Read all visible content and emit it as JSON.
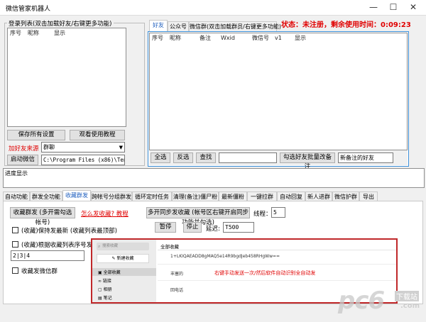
{
  "window": {
    "title": "微信管家机器人",
    "minimize": "—",
    "maximize": "☐",
    "close": "✕"
  },
  "login": {
    "group_label": "登录列表(双击加载好友/右键更多功能)",
    "columns": [
      "序号",
      "昵称",
      "显示"
    ],
    "save_btn": "保存所有设置",
    "tutorial_btn": "观看使用教程",
    "source_label": "加好友来源",
    "source_value": "群聊",
    "start_btn": "启动微信",
    "path_value": "C:\\Program Files (x86)\\Tencent\\We"
  },
  "status": {
    "text": "状态：未注册，剩余使用时间：0:09:23",
    "color": "#e00000"
  },
  "friends": {
    "tabs": [
      "好友",
      "公众号",
      "微信群(双击加载群员/右键更多功能)"
    ],
    "columns": [
      "序号",
      "昵称",
      "备注",
      "Wxid",
      "微信号",
      "v1",
      "显示"
    ],
    "select_all": "全选",
    "invert": "反选",
    "search": "查找",
    "batch_remark": "勾选好友批量改备注",
    "search_value": "",
    "remark_value": "新备注的好友"
  },
  "progress_label": "进度显示",
  "func_tabs": [
    "自动功能",
    "群发全功能",
    "收藏群发",
    "跨帐号分组群发",
    "循环定时任务",
    "清理(备注)僵尸粉",
    "最新僵粉",
    "一键拉群",
    "自动回复",
    "新人进群",
    "微信护群",
    "导出"
  ],
  "collect": {
    "group_send_btn": "收藏群发 (多开需勾选帐号)",
    "how_link": "怎么发收藏? 教程",
    "multi_sync_btn": "多开同步发收藏 (帐号区右键开启同步功能并勾选)",
    "thread_label": "线程：",
    "thread_value": "5",
    "chk_latest": "(收藏)保持发最新 (收藏列表最顶部)",
    "chk_by_index": "(收藏)根据收藏列表序号发",
    "index_value": "2|3|4",
    "chk_wechat_group": "收藏发微信群",
    "pause_btn": "暂停",
    "stop_btn": "停止",
    "delay_label": "延迟:",
    "delay_value": "T500"
  },
  "preview": {
    "search_placeholder": "搜索收藏",
    "new_btn": "新建收藏",
    "side_items": [
      "全部收藏",
      "链接",
      "相册",
      "笔记"
    ],
    "header": "全部收藏",
    "row1": "1+LKIQAEADD8gMAQ5e14R9bgdJeb458RHgWw==",
    "row2": "丰塞的",
    "row3": "回电话",
    "hint": "右键手动发送一次/然后软件自动识别全自动发"
  },
  "watermark": {
    "text": "pc6",
    "sub": "下载站",
    "domain": ".com"
  }
}
